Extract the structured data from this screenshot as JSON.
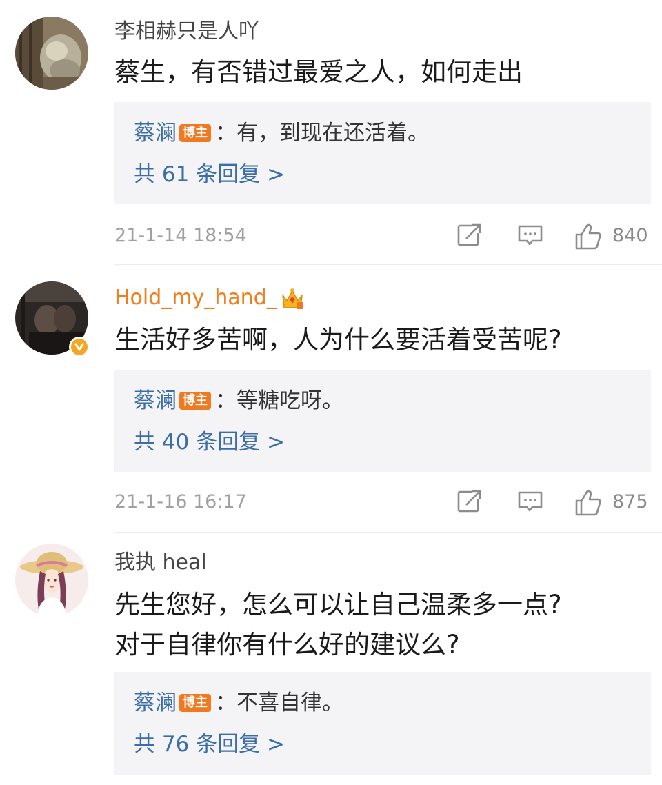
{
  "comments": [
    {
      "username": "李相赫只是人吖",
      "text_lines": [
        "蔡生，有否错过最爱之人，如何走出"
      ],
      "reply": {
        "author": "蔡澜",
        "badge": "博主",
        "separator": "：",
        "content": "有，到现在还活着。"
      },
      "more_replies": "共 61 条回复 >",
      "timestamp": "21-1-14 18:54",
      "likes": "840"
    },
    {
      "username": "Hold_my_hand_",
      "text_lines": [
        "生活好多苦啊，人为什么要活着受苦呢?"
      ],
      "reply": {
        "author": "蔡澜",
        "badge": "博主",
        "separator": "：",
        "content": "等糖吃呀。"
      },
      "more_replies": "共 40 条回复 >",
      "timestamp": "21-1-16 16:17",
      "likes": "875"
    },
    {
      "username": "我执 heal",
      "text_lines": [
        "先生您好，怎么可以让自己温柔多一点?",
        "对于自律你有什么好的建议么?"
      ],
      "reply": {
        "author": "蔡澜",
        "badge": "博主",
        "separator": "：",
        "content": "不喜自律。"
      },
      "more_replies": "共 76 条回复 >"
    }
  ],
  "colors": {
    "link_blue": "#3b6ea8",
    "vip_orange": "#f07d1e",
    "badge_orange": "#f07a22",
    "reply_bg": "#f4f4f6",
    "meta_gray": "#a0a0a0"
  },
  "icons": [
    "share-icon",
    "comment-icon",
    "like-icon",
    "crown-icon",
    "verified-icon"
  ]
}
